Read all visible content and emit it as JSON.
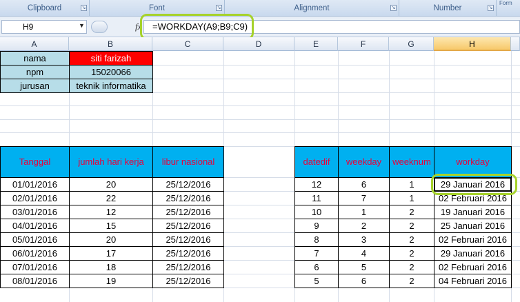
{
  "ribbon": {
    "groups": [
      {
        "label": "Clipboard"
      },
      {
        "label": "Font"
      },
      {
        "label": "Alignment"
      },
      {
        "label": "Number"
      }
    ],
    "stub_label": "Form"
  },
  "formula_bar": {
    "name_box": "H9",
    "fx": "fx",
    "formula": "=WORKDAY(A9;B9;C9)"
  },
  "columns": [
    "A",
    "B",
    "C",
    "D",
    "E",
    "F",
    "G",
    "H"
  ],
  "active_column": "H",
  "info": [
    {
      "label": "nama",
      "value": "siti farizah"
    },
    {
      "label": "npm",
      "value": "15020066"
    },
    {
      "label": "jurusan",
      "value": "teknik informatika"
    }
  ],
  "left_table": {
    "headers": [
      "Tanggal",
      "jumlah hari kerja",
      "libur nasional"
    ],
    "rows": [
      [
        "01/01/2016",
        "20",
        "25/12/2016"
      ],
      [
        "02/01/2016",
        "22",
        "25/12/2016"
      ],
      [
        "03/01/2016",
        "12",
        "25/12/2016"
      ],
      [
        "04/01/2016",
        "15",
        "25/12/2016"
      ],
      [
        "05/01/2016",
        "20",
        "25/12/2016"
      ],
      [
        "06/01/2016",
        "17",
        "25/12/2016"
      ],
      [
        "07/01/2016",
        "18",
        "25/12/2016"
      ],
      [
        "08/01/2016",
        "19",
        "25/12/2016"
      ]
    ]
  },
  "right_table": {
    "headers": [
      "datedif",
      "weekday",
      "weeknum",
      "workday"
    ],
    "rows": [
      [
        "12",
        "6",
        "1",
        "29 Januari 2016"
      ],
      [
        "11",
        "7",
        "1",
        "02 Februari 2016"
      ],
      [
        "10",
        "1",
        "2",
        "19 Januari 2016"
      ],
      [
        "9",
        "2",
        "2",
        "25 Januari 2016"
      ],
      [
        "8",
        "3",
        "2",
        "02 Februari 2016"
      ],
      [
        "7",
        "4",
        "2",
        "29 Januari 2016"
      ],
      [
        "6",
        "5",
        "2",
        "02 Februari 2016"
      ],
      [
        "5",
        "6",
        "2",
        "04 Februari 2016"
      ]
    ]
  },
  "colors": {
    "highlight": "#a6d22b",
    "header_fill": "#00b0f0",
    "header_text": "#e8003c",
    "info_fill": "#b7dde8",
    "name_fill": "#ff0000"
  }
}
